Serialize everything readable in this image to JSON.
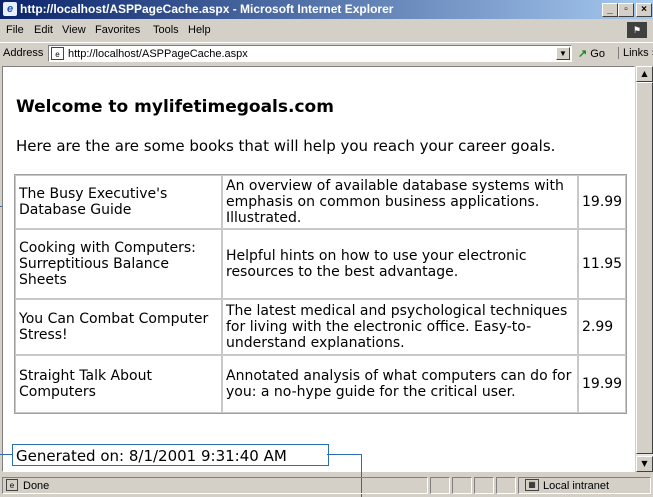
{
  "window": {
    "title": "http://localhost/ASPPageCache.aspx - Microsoft Internet Explorer",
    "minimize": "_",
    "maximize": "▫",
    "close": "×"
  },
  "menu": [
    "File",
    "Edit",
    "View",
    "Favorites",
    "Tools",
    "Help"
  ],
  "address": {
    "label": "Address",
    "url": "http://localhost/ASPPageCache.aspx",
    "go": "Go",
    "links": "Links »"
  },
  "page": {
    "heading": "Welcome to mylifetimegoals.com",
    "intro": "Here are the are some books that will help you reach your career goals.",
    "books": [
      {
        "title": "The Busy Executive's Database Guide",
        "description": "An overview of available database systems with emphasis on common business applications. Illustrated.",
        "price": "19.99"
      },
      {
        "title": "Cooking with Computers: Surreptitious Balance Sheets",
        "description": "Helpful hints on how to use your electronic resources to the best advantage.",
        "price": "11.95"
      },
      {
        "title": "You Can Combat Computer Stress!",
        "description": "The latest medical and psychological techniques for living with the electronic office. Easy-to-understand explanations.",
        "price": "2.99"
      },
      {
        "title": "Straight Talk About Computers",
        "description": "Annotated analysis of what computers can do for you: a no-hype guide for the critical user.",
        "price": "19.99"
      }
    ],
    "generated": "Generated on: 8/1/2001 9:31:40 AM"
  },
  "status": {
    "text": "Done",
    "zone": "Local intranet"
  },
  "colors": {
    "titlebar_start": "#0a246a",
    "titlebar_end": "#a6caf0",
    "callout": "#2a6eb0"
  }
}
